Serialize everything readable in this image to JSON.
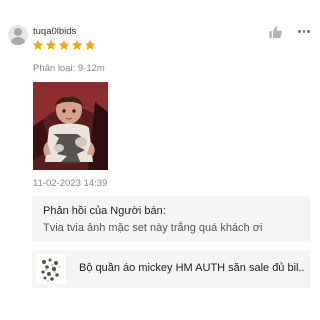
{
  "review": {
    "username": "tuqa0lbids",
    "rating": 5,
    "variation_text": "Phân loại: 9-12m",
    "timestamp": "11-02-2023 14:39",
    "icons": {
      "avatar": "user-avatar-icon",
      "like": "thumbs-up-icon",
      "more": "more-options-icon"
    },
    "star_color": "#f6a700"
  },
  "seller_reply": {
    "title": "Phản hồi của Người bán:",
    "text": "Tvia tvia ảnh mặc set này trắng quá khách ơi"
  },
  "product": {
    "name": "Bộ quần áo mickey HM AUTH săn sale đủ bil..."
  }
}
